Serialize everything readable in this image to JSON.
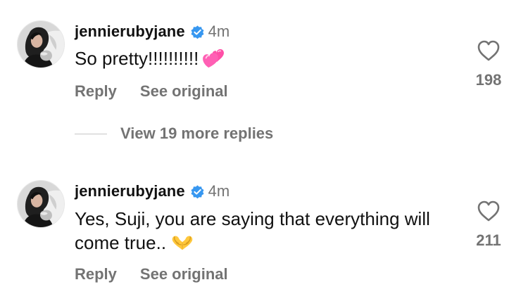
{
  "comments": [
    {
      "username": "jennierubyjane",
      "timestamp": "4m",
      "text": "So pretty!!!!!!!!!!",
      "emoji": "two-hearts-emoji",
      "reply_label": "Reply",
      "see_original_label": "See original",
      "like_count": "198",
      "verified": true
    },
    {
      "username": "jennierubyjane",
      "timestamp": "4m",
      "text": "Yes, Suji, you are saying that everything will come true..",
      "emoji": "heart-hands-emoji",
      "reply_label": "Reply",
      "see_original_label": "See original",
      "like_count": "211",
      "verified": true
    }
  ],
  "view_replies_label": "View 19 more replies",
  "colors": {
    "text": "#111111",
    "secondary": "#737373",
    "verified": "#3797f0",
    "line": "#c7c7c7"
  },
  "icons": {
    "verified": "verified-badge-icon",
    "like": "heart-outline-icon"
  }
}
